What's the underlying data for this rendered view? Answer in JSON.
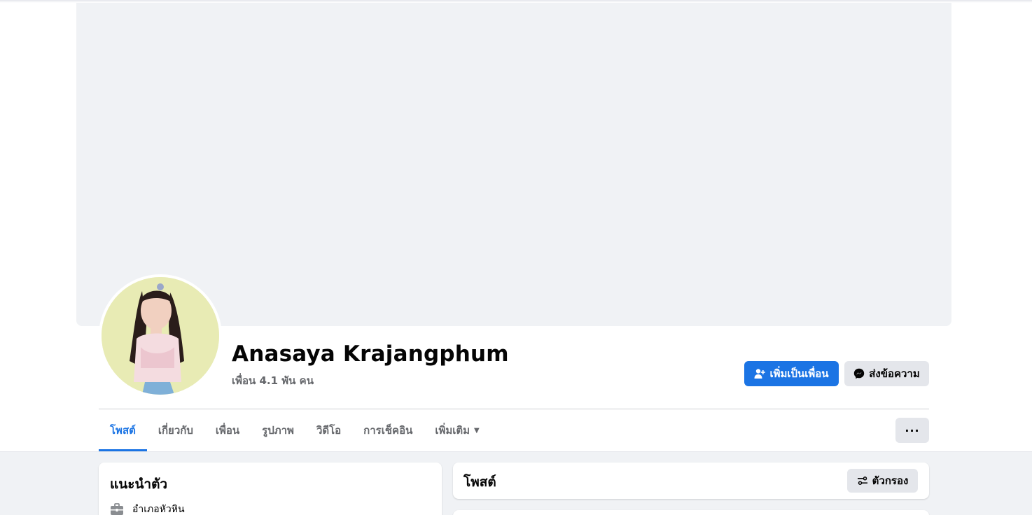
{
  "profile": {
    "name": "Anasaya Krajangphum",
    "friend_count": "เพื่อน 4.1 พัน คน"
  },
  "actions": {
    "add_friend_label": "เพิ่มเป็นเพื่อน",
    "message_label": "ส่งข้อความ",
    "more_label": "···"
  },
  "tabs": [
    {
      "label": "โพสต์",
      "active": true
    },
    {
      "label": "เกี่ยวกับ",
      "active": false
    },
    {
      "label": "เพื่อน",
      "active": false
    },
    {
      "label": "รูปภาพ",
      "active": false
    },
    {
      "label": "วิดีโอ",
      "active": false
    },
    {
      "label": "การเช็คอิน",
      "active": false
    },
    {
      "label": "เพิ่มเติม",
      "active": false
    }
  ],
  "intro": {
    "title": "แนะนำตัว",
    "work": "อำเภอหัวหิน"
  },
  "posts": {
    "title": "โพสต์",
    "filter_label": "ตัวกรอง"
  },
  "colors": {
    "accent": "#1b74e4",
    "background": "#f0f2f5",
    "secondary_text": "#65676b",
    "button_gray": "#e4e6eb"
  },
  "icons": {
    "add_friend": "person-plus-icon",
    "message": "messenger-icon",
    "more_caret": "caret-down-icon",
    "more": "ellipsis-icon",
    "work": "briefcase-icon",
    "filter": "sliders-icon"
  }
}
